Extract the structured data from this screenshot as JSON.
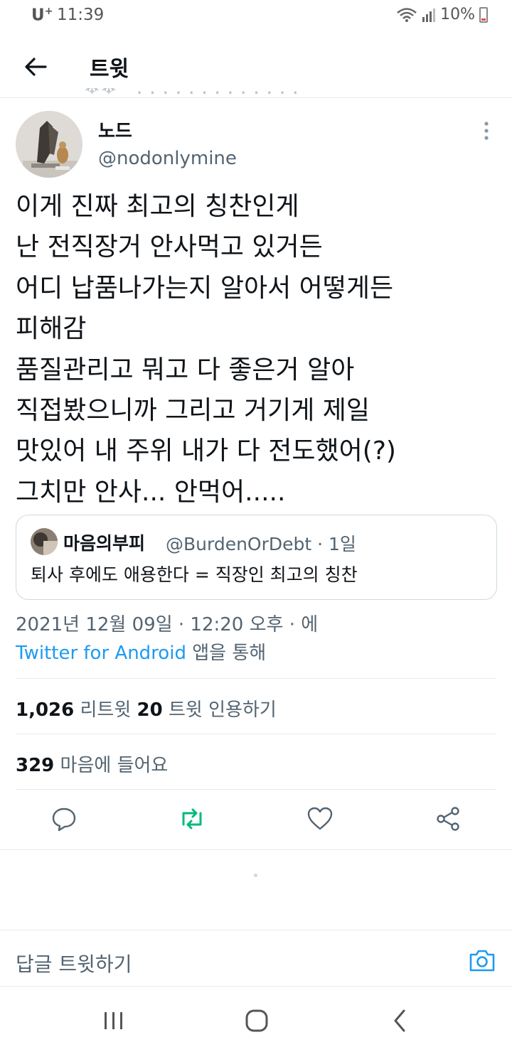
{
  "status_bar": {
    "carrier": "U",
    "carrier_sup": "+",
    "time": "11:39",
    "battery": "10%"
  },
  "header": {
    "title": "트윗"
  },
  "tweet": {
    "author_name": "노드",
    "author_handle": "@nodonlymine",
    "lines": [
      "이게 진짜 최고의 칭찬인게",
      "난 전직장거 안사먹고 있거든",
      "어디 납품나가는지 알아서 어떻게든",
      "피해감",
      "품질관리고 뭐고 다 좋은거 알아",
      "직접봤으니까 그리고 거기게 제일",
      "맛있어 내 주위 내가 다 전도했어(?)",
      "그치만 안사... 안먹어....."
    ],
    "datetime": "2021년 12월 09일 · 12:20 오후 · 에",
    "source_link": "Twitter for Android",
    "source_suffix": " 앱을 통해"
  },
  "quote": {
    "name": "마음의부피",
    "meta": "@BurdenOrDebt · 1일",
    "text": "퇴사 후에도 애용한다 = 직장인 최고의 칭찬"
  },
  "stats": {
    "retweets_count": "1,026",
    "retweets_label": " 리트윗  ",
    "quotes_count": "20",
    "quotes_label": " 트윗 인용하기",
    "likes_count": "329",
    "likes_label": " 마음에 들어요"
  },
  "reply": {
    "placeholder": "답글 트윗하기"
  },
  "colors": {
    "accent": "#1d9bf0",
    "retweet": "#00ba7c",
    "muted": "#536471"
  },
  "icons": {
    "back": "arrow-left-icon",
    "more": "more-vertical-icon",
    "reply": "comment-icon",
    "retweet": "retweet-icon",
    "like": "heart-icon",
    "share": "share-icon",
    "camera": "camera-icon"
  }
}
